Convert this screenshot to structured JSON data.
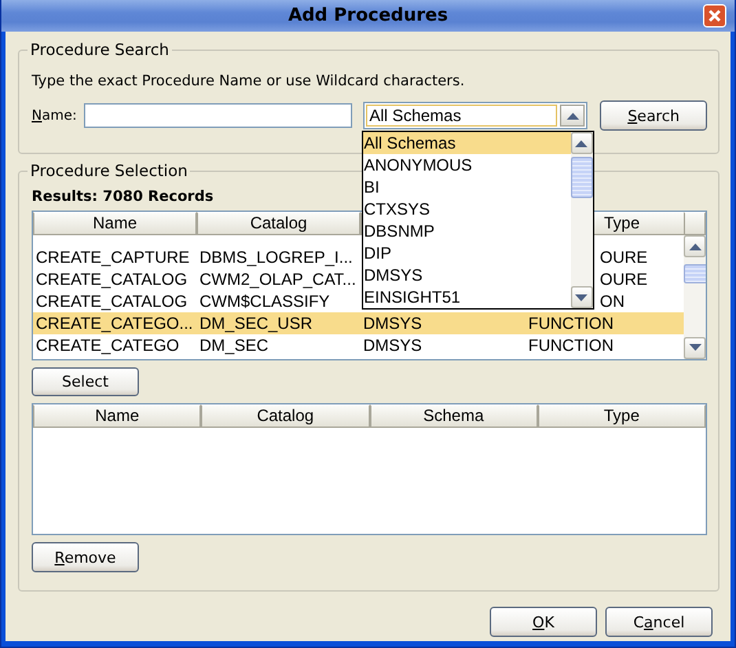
{
  "window": {
    "title": "Add Procedures"
  },
  "search": {
    "legend": "Procedure Search",
    "hint": "Type the exact Procedure Name or use Wildcard characters.",
    "name_label": {
      "key": "N",
      "after": "ame:"
    },
    "schema_value": "All Schemas",
    "button": {
      "key": "S",
      "after": "earch"
    },
    "schema_options": [
      {
        "label": "All Schemas",
        "selected": true
      },
      {
        "label": "ANONYMOUS",
        "selected": false
      },
      {
        "label": "BI",
        "selected": false
      },
      {
        "label": "CTXSYS",
        "selected": false
      },
      {
        "label": "DBSNMP",
        "selected": false
      },
      {
        "label": "DIP",
        "selected": false
      },
      {
        "label": "DMSYS",
        "selected": false
      },
      {
        "label": "EINSIGHT51",
        "selected": false
      }
    ]
  },
  "selection": {
    "legend": "Procedure Selection",
    "results": "Results: 7080 Records",
    "columns": [
      "Name",
      "Catalog",
      "Type"
    ],
    "rows": [
      {
        "name": "CREATE_CAPTURE",
        "catalog": "DBMS_LOGREP_I...",
        "type": "OURE",
        "covered": true,
        "selected": false
      },
      {
        "name": "CREATE_CATALOG",
        "catalog": "CWM2_OLAP_CAT...",
        "type": "OURE",
        "covered": true,
        "selected": false
      },
      {
        "name": "CREATE_CATALOG",
        "catalog": "CWM$CLASSIFY",
        "type": "ON",
        "covered": true,
        "selected": false
      },
      {
        "name": "CREATE_CATEGO...",
        "catalog": "DM_SEC_USR",
        "schema": "DMSYS",
        "type": "FUNCTION",
        "covered": false,
        "selected": true
      },
      {
        "name": "CREATE_CATEGO",
        "catalog": "DM_SEC",
        "schema": "DMSYS",
        "type": "FUNCTION",
        "covered": false,
        "selected": false
      }
    ],
    "select_button": {
      "label": "Select"
    },
    "chosen_columns": [
      "Name",
      "Catalog",
      "Schema",
      "Type"
    ],
    "remove_button": {
      "key": "R",
      "after": "emove"
    }
  },
  "buttons": [
    {
      "key": "O",
      "after": "K"
    },
    {
      "before": "C",
      "key": "a",
      "after": "ncel"
    }
  ]
}
